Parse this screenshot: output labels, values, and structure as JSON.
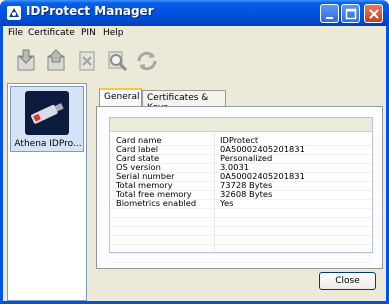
{
  "window": {
    "title": "IDProtect Manager"
  },
  "menu": [
    {
      "label": "File"
    },
    {
      "label": "Certificate"
    },
    {
      "label": "PIN"
    },
    {
      "label": "Help"
    }
  ],
  "toolbar": {
    "tools": [
      "import-icon",
      "export-icon",
      "delete-icon",
      "inspect-icon",
      "refresh-icon"
    ]
  },
  "devices": [
    {
      "label": "Athena IDPro..."
    }
  ],
  "tabs": [
    {
      "label": "General"
    },
    {
      "label": "Certificates & Keys"
    }
  ],
  "details": [
    {
      "key": "Card name",
      "value": "IDProtect"
    },
    {
      "key": "Card label",
      "value": "0A50002405201831"
    },
    {
      "key": "Card state",
      "value": "Personalized"
    },
    {
      "key": "OS version",
      "value": "3.0031"
    },
    {
      "key": "Serial number",
      "value": "0A50002405201831"
    },
    {
      "key": "Total memory",
      "value": "73728 Bytes"
    },
    {
      "key": "Total free memory",
      "value": "32608 Bytes"
    },
    {
      "key": "Biometrics enabled",
      "value": "Yes"
    }
  ],
  "buttons": {
    "close": "Close"
  },
  "colors": {
    "titlebar": "#0054e3",
    "face": "#ece9d8",
    "active_tab_accent": "#ffc83c"
  }
}
